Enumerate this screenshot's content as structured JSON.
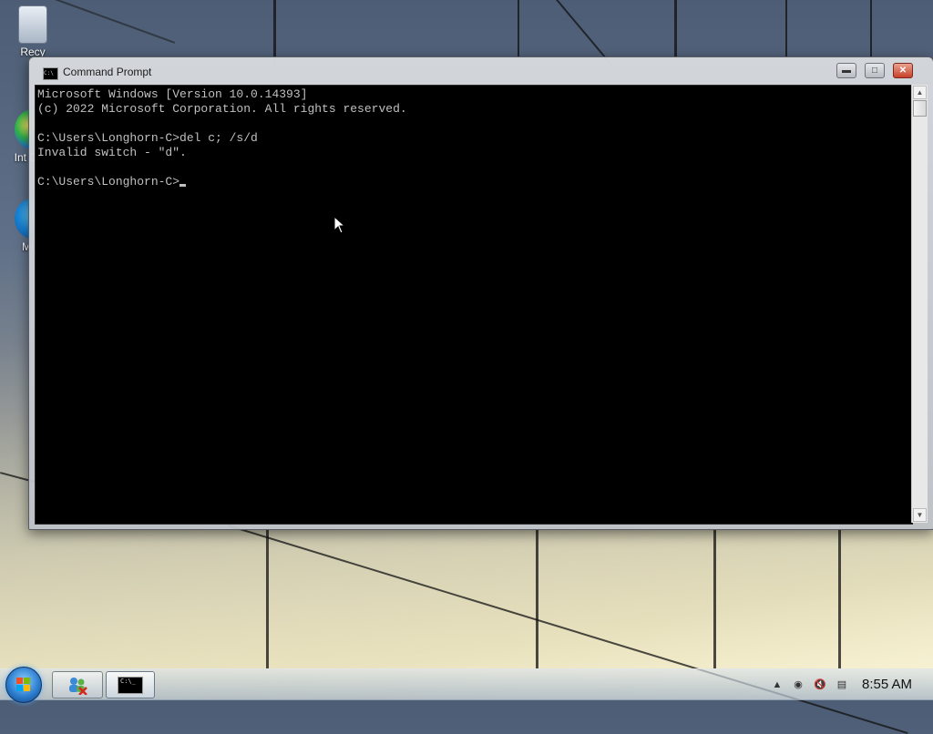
{
  "desktop": {
    "icons": [
      {
        "label": "Recy",
        "icon": "recycle-bin-icon"
      },
      {
        "label": "Int Dow",
        "icon": "internet-download-manager-icon"
      },
      {
        "label": "Mi E",
        "icon": "microsoft-edge-icon"
      }
    ]
  },
  "window": {
    "title": "Command Prompt",
    "icon": "cmd-icon",
    "controls": {
      "minimize": "minimize-icon",
      "maximize": "maximize-icon",
      "close": "close-icon"
    }
  },
  "console": {
    "lines": [
      "Microsoft Windows [Version 10.0.14393]",
      "(c) 2022 Microsoft Corporation. All rights reserved.",
      "",
      "C:\\Users\\Longhorn-C>del c; /s/d",
      "Invalid switch - \"d\".",
      ""
    ],
    "prompt": "C:\\Users\\Longhorn-C>"
  },
  "taskbar": {
    "start": "windows-start-icon",
    "pinned": [
      {
        "name": "people-network-icon"
      },
      {
        "name": "command-prompt-icon",
        "label": "C:\\_"
      }
    ],
    "tray": [
      "show-hidden-icons-icon",
      "network-icon",
      "volume-muted-icon",
      "action-center-icon"
    ],
    "clock": "8:55 AM"
  },
  "colors": {
    "console_bg": "#000000",
    "console_fg": "#c0c0c0",
    "close_button": "#c8402a"
  }
}
